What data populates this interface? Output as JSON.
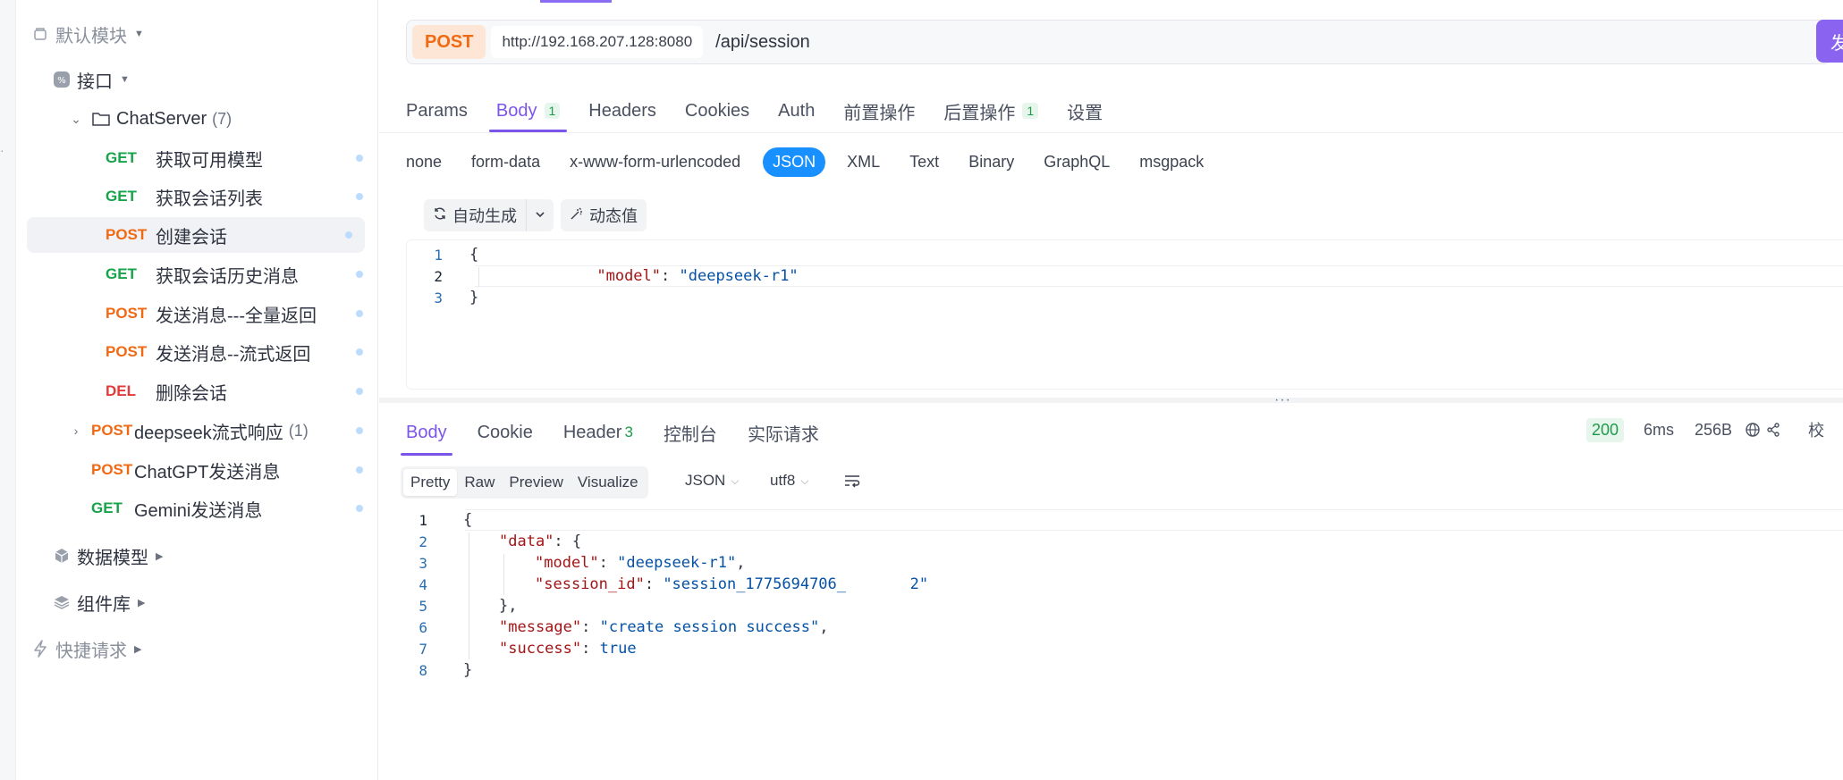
{
  "sidebar": {
    "module": {
      "label": "默认模块"
    },
    "interfaces": {
      "label": "接口"
    },
    "folder": {
      "label": "ChatServer",
      "count": "(7)"
    },
    "endpoints": [
      {
        "method": "GET",
        "name": "获取可用模型"
      },
      {
        "method": "GET",
        "name": "获取会话列表"
      },
      {
        "method": "POST",
        "name": "创建会话"
      },
      {
        "method": "GET",
        "name": "获取会话历史消息"
      },
      {
        "method": "POST",
        "name": "发送消息---全量返回"
      },
      {
        "method": "POST",
        "name": "发送消息--流式返回"
      },
      {
        "method": "DEL",
        "name": "删除会话"
      }
    ],
    "extra_endpoints": [
      {
        "method": "POST",
        "name": "deepseek流式响应",
        "count": "(1)"
      },
      {
        "method": "POST",
        "name": "ChatGPT发送消息"
      },
      {
        "method": "GET",
        "name": "Gemini发送消息"
      }
    ],
    "data_models": {
      "label": "数据模型"
    },
    "components": {
      "label": "组件库"
    },
    "quick_requests": {
      "label": "快捷请求"
    }
  },
  "request": {
    "method": "POST",
    "host": "http://192.168.207.128:8080",
    "path": "/api/session",
    "send_label": "发"
  },
  "request_tabs": [
    {
      "label": "Params"
    },
    {
      "label": "Body",
      "badge": "1"
    },
    {
      "label": "Headers"
    },
    {
      "label": "Cookies"
    },
    {
      "label": "Auth"
    },
    {
      "label": "前置操作"
    },
    {
      "label": "后置操作",
      "badge": "1"
    },
    {
      "label": "设置"
    }
  ],
  "body_types": [
    "none",
    "form-data",
    "x-www-form-urlencoded",
    "JSON",
    "XML",
    "Text",
    "Binary",
    "GraphQL",
    "msgpack"
  ],
  "editor_toolbar": {
    "auto_generate": "自动生成",
    "dynamic_value": "动态值"
  },
  "request_body": {
    "line_numbers": [
      "1",
      "2",
      "3"
    ],
    "open": "{",
    "key": "\"model\"",
    "colon": ": ",
    "value": "\"deepseek-r1\"",
    "close": "}"
  },
  "response_tabs": [
    {
      "label": "Body"
    },
    {
      "label": "Cookie"
    },
    {
      "label": "Header",
      "count": "3"
    },
    {
      "label": "控制台"
    },
    {
      "label": "实际请求"
    }
  ],
  "response_meta": {
    "status": "200",
    "time": "6ms",
    "size": "256B",
    "validate": "校"
  },
  "view_modes": [
    "Pretty",
    "Raw",
    "Preview",
    "Visualize"
  ],
  "format": "JSON",
  "encoding": "utf8",
  "response_body": {
    "line_numbers": [
      "1",
      "2",
      "3",
      "4",
      "5",
      "6",
      "7",
      "8"
    ],
    "l1": "{",
    "l2_key": "\"data\"",
    "l2_rest": ": {",
    "l3_key": "\"model\"",
    "l3_val": "\"deepseek-r1\"",
    "l4_key": "\"session_id\"",
    "l4_val": "\"session_1775694706_       2\"",
    "l5": "},",
    "l6_key": "\"message\"",
    "l6_val": "\"create session success\"",
    "l7_key": "\"success\"",
    "l7_val": "true",
    "l8": "}"
  },
  "colors": {
    "accent": "#7b55ea",
    "post": "#f06a14",
    "get": "#17a34a",
    "del": "#e23b3b",
    "json_active": "#1890ff"
  }
}
